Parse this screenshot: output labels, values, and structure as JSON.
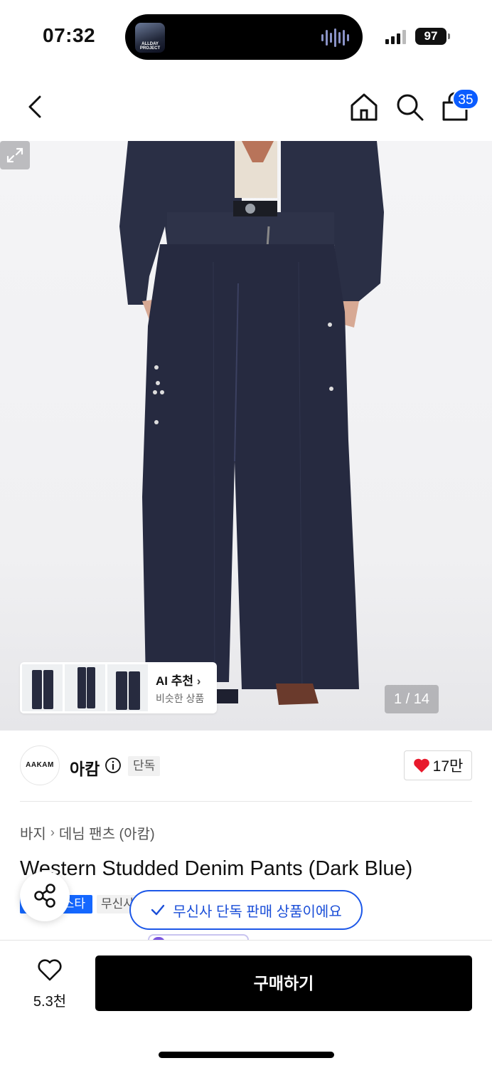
{
  "status_bar": {
    "time": "07:32",
    "battery": "97",
    "now_playing_art_text": "ALLDAY PROJECT"
  },
  "header": {
    "cart_count": "35"
  },
  "gallery": {
    "page_indicator": "1 / 14",
    "ai_recommend": {
      "title": "AI 추천",
      "subtitle": "비슷한 상품"
    }
  },
  "brand": {
    "logo_text": "AAKAM",
    "name": "아캄",
    "tag": "단독",
    "likes": "17만"
  },
  "breadcrumb": {
    "category": "바지",
    "subcategory": "데님 팬츠 (아캄)"
  },
  "product": {
    "title": "Western Studded Denim Pants (Dark Blue)"
  },
  "badges": {
    "blue_tag": "스타",
    "gray_tag": "무신사"
  },
  "toast": {
    "exclusive": "무신사 단독 판매 상품이에요"
  },
  "bottom_bar": {
    "wish_count": "5.3천",
    "buy_label": "구매하기"
  },
  "colors": {
    "accent_blue": "#1467ff",
    "heart_red": "#e8192c",
    "denim": "#262a40"
  }
}
